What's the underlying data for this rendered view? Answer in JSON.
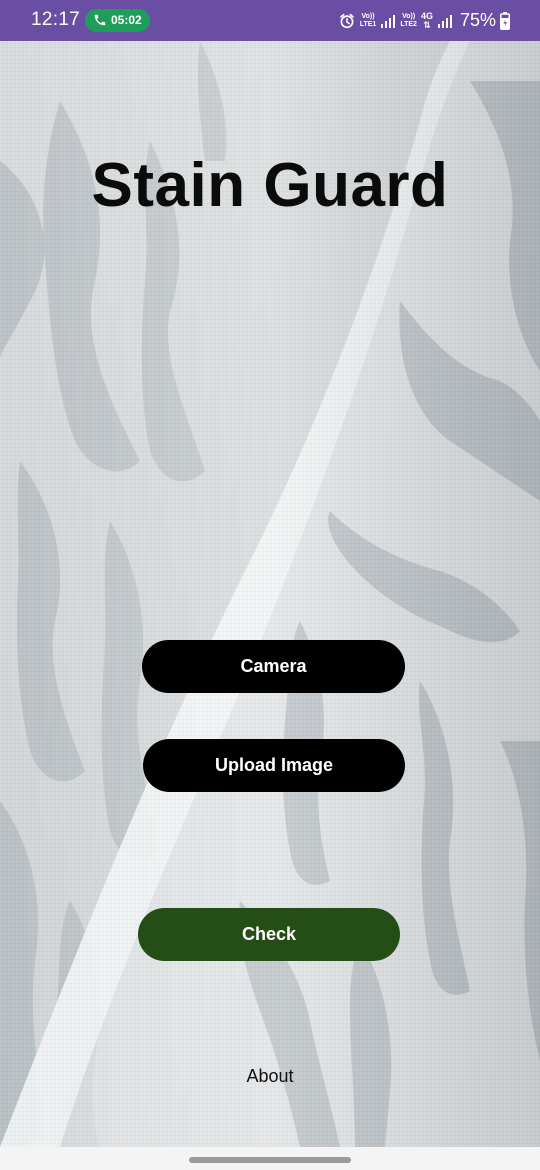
{
  "status_bar": {
    "time": "12:17",
    "call_timer": "05:02",
    "sim1_label_top": "Vo))",
    "sim1_label_bottom": "LTE1",
    "sim2_label_top": "Vo))",
    "sim2_label_bottom": "LTE2",
    "network_type": "4G",
    "battery": "75%",
    "background_color": "#6a4ea4",
    "icons": [
      "phone-icon",
      "alarm-icon",
      "signal-icon",
      "battery-charging-icon"
    ]
  },
  "app": {
    "title": "Stain Guard"
  },
  "buttons": {
    "camera_label": "Camera",
    "upload_label": "Upload Image",
    "check_label": "Check",
    "about_label": "About"
  },
  "colors": {
    "primary_button": "#000000",
    "check_button": "#254e17"
  }
}
